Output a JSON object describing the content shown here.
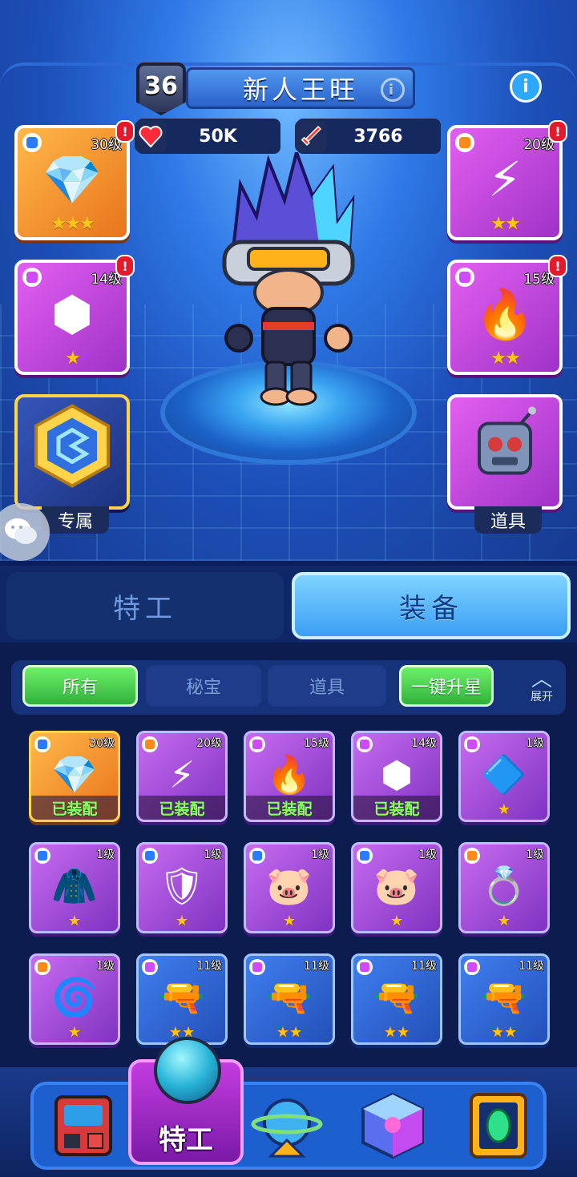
{
  "profile": {
    "level": "36",
    "name": "新人王旺",
    "name_info_icon": "i",
    "info_icon": "i"
  },
  "stats": {
    "hp": "50K",
    "attack": "3766"
  },
  "left_slots": [
    {
      "level": "30级",
      "alert": "!",
      "stars": "★★★",
      "art": "crystal-blade-icon"
    },
    {
      "level": "14级",
      "alert": "!",
      "stars": "★",
      "art": "armor-cube-icon"
    },
    {
      "caption": "专属",
      "art": "hexagon-emblem-icon"
    }
  ],
  "right_slots": [
    {
      "level": "20级",
      "alert": "!",
      "stars": "★★",
      "art": "lightning-blade-icon"
    },
    {
      "level": "15级",
      "alert": "!",
      "stars": "★★",
      "art": "green-flame-icon"
    },
    {
      "caption": "道具",
      "art": "robot-gadget-icon"
    }
  ],
  "tabs": {
    "agent": "特工",
    "equipment": "装备"
  },
  "filters": {
    "all": "所有",
    "treasure": "秘宝",
    "item": "道具",
    "upgrade_all": "一键升星",
    "expand": "展开"
  },
  "inventory": [
    {
      "level": "30级",
      "badge": "已装配",
      "color": "orange",
      "rarity": "#2a7cff",
      "art": "💎"
    },
    {
      "level": "20级",
      "badge": "已装配",
      "color": "purple",
      "rarity": "#ff8a1a",
      "art": "⚡"
    },
    {
      "level": "15级",
      "badge": "已装配",
      "color": "purple",
      "rarity": "#d04bff",
      "art": "🔥"
    },
    {
      "level": "14级",
      "badge": "已装配",
      "color": "purple",
      "rarity": "#d04bff",
      "art": "⬢"
    },
    {
      "level": "1级",
      "stars": "★",
      "color": "purple",
      "rarity": "#d04bff",
      "art": "🔷"
    },
    {
      "level": "1级",
      "stars": "★",
      "color": "purple",
      "rarity": "#2a7cff",
      "art": "🧥"
    },
    {
      "level": "1级",
      "stars": "★",
      "color": "purple",
      "rarity": "#2a7cff",
      "art": "🛡"
    },
    {
      "level": "1级",
      "stars": "★",
      "color": "purple",
      "rarity": "#2a7cff",
      "art": "🐷"
    },
    {
      "level": "1级",
      "stars": "★",
      "color": "purple",
      "rarity": "#2a7cff",
      "art": "🐷"
    },
    {
      "level": "1级",
      "stars": "★",
      "color": "purple",
      "rarity": "#ff8a1a",
      "art": "💍"
    },
    {
      "level": "1级",
      "stars": "★",
      "color": "purple",
      "rarity": "#ff8a1a",
      "art": "🌀"
    },
    {
      "level": "11级",
      "stars": "★★",
      "color": "blue",
      "rarity": "#d04bff",
      "art": "🔫"
    },
    {
      "level": "11级",
      "stars": "★★",
      "color": "blue",
      "rarity": "#d04bff",
      "art": "🔫"
    },
    {
      "level": "11级",
      "stars": "★★",
      "color": "blue",
      "rarity": "#d04bff",
      "art": "🔫"
    },
    {
      "level": "11级",
      "stars": "★★",
      "color": "blue",
      "rarity": "#d04bff",
      "art": "🔫"
    }
  ],
  "bottom_nav": {
    "active_label": "特工",
    "items": [
      "arcade-machine-icon",
      "agent-helmet-icon",
      "planet-icon",
      "crystal-cube-icon",
      "emerald-frame-icon"
    ]
  }
}
